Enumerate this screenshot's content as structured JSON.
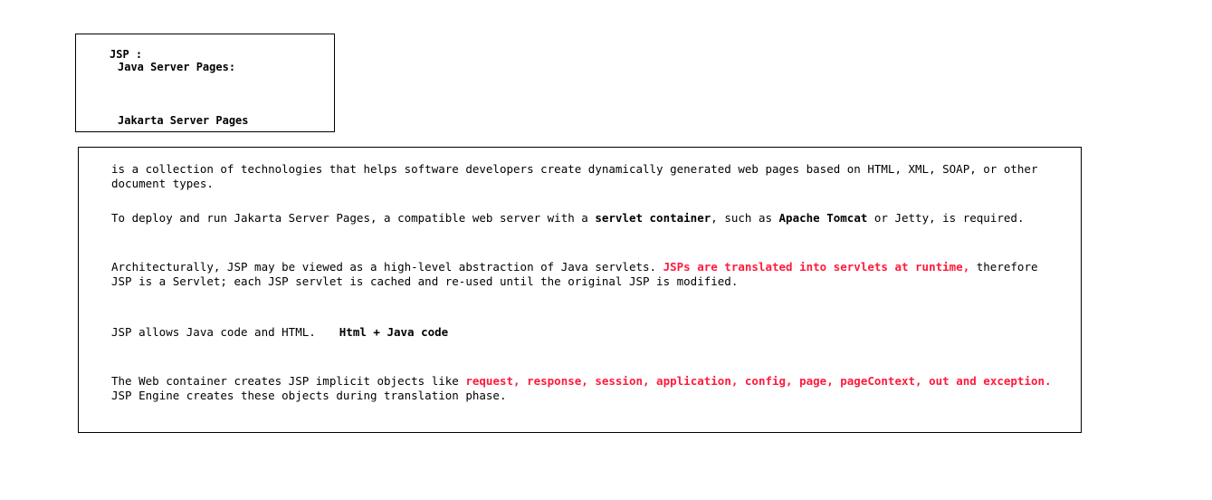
{
  "header": {
    "acronym": "JSP :",
    "name_old": "Java Server Pages:",
    "name_new": "Jakarta Server Pages"
  },
  "colors": {
    "highlight": "#ff1a3c",
    "text": "#000000",
    "border": "#000000"
  },
  "paragraphs": {
    "p1": {
      "text": "is a collection of technologies that helps software developers create dynamically generated web pages based on HTML, XML, SOAP, or other document types."
    },
    "p2": {
      "text_a": "To deploy and run Jakarta Server Pages, a compatible web server with a ",
      "bold_a": "servlet container",
      "text_b": ", such as ",
      "bold_b": "Apache Tomcat",
      "text_c": " or Jetty, is required."
    },
    "p3": {
      "text_a": "Architecturally, JSP may be viewed as a high-level abstraction of Java servlets. ",
      "red_a": "JSPs are translated into servlets at runtime,",
      "text_b": " therefore JSP is a Servlet; each JSP servlet is cached and re-used until the original JSP is modified."
    },
    "p4": {
      "text_a": "JSP allows Java code and HTML.",
      "bold_a": "Html + Java code"
    },
    "p5": {
      "text_a": "The Web container creates JSP implicit objects like ",
      "red_a": "request, response, session, application, config, page, pageContext, out and exception.",
      "text_b": " JSP Engine creates these objects during translation phase."
    }
  }
}
